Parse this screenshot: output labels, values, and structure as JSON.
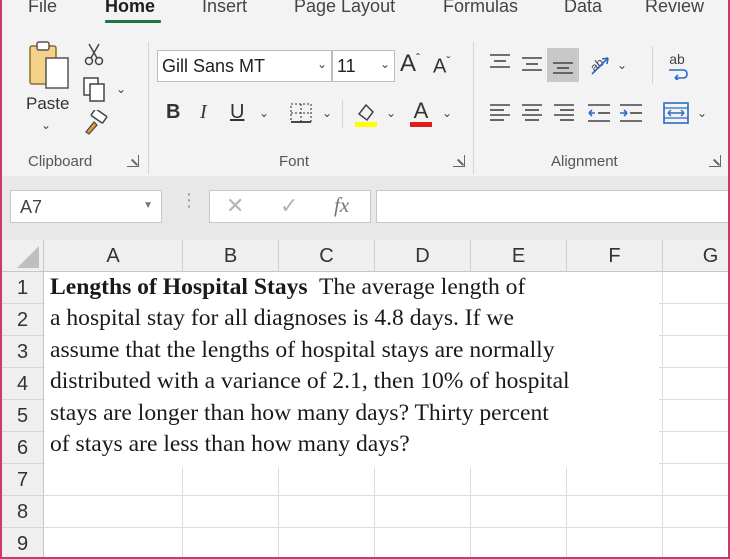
{
  "ribbon": {
    "tabs": [
      "File",
      "Home",
      "Insert",
      "Page Layout",
      "Formulas",
      "Data",
      "Review"
    ],
    "active_tab": "Home",
    "clipboard": {
      "paste_label": "Paste",
      "group_label": "Clipboard"
    },
    "font": {
      "font_name": "Gill Sans MT",
      "font_size": "11",
      "group_label": "Font",
      "bold": "B",
      "italic": "I",
      "underline": "U"
    },
    "alignment": {
      "group_label": "Alignment",
      "wrap_label": "ab"
    },
    "colors": {
      "highlight": "#ffff00",
      "font_color": "#e01b1b",
      "accent": "#217346"
    }
  },
  "formula_bar": {
    "name_box": "A7",
    "fx": "fx",
    "formula": ""
  },
  "grid": {
    "columns": [
      "A",
      "B",
      "C",
      "D",
      "E",
      "F",
      "G"
    ],
    "rows": [
      "1",
      "2",
      "3",
      "4",
      "5",
      "6",
      "7",
      "8",
      "9"
    ]
  },
  "problem": {
    "title": "Lengths of Hospital Stays",
    "line1_rest": "  The average length of",
    "line2": "a hospital stay for all diagnoses is 4.8 days. If we",
    "line3": "assume that the lengths of hospital stays are normally",
    "line4": "distributed with a variance of 2.1, then 10% of hospital",
    "line5": "stays are longer than how many days? Thirty percent",
    "line6": "of stays are less than how many days?"
  }
}
